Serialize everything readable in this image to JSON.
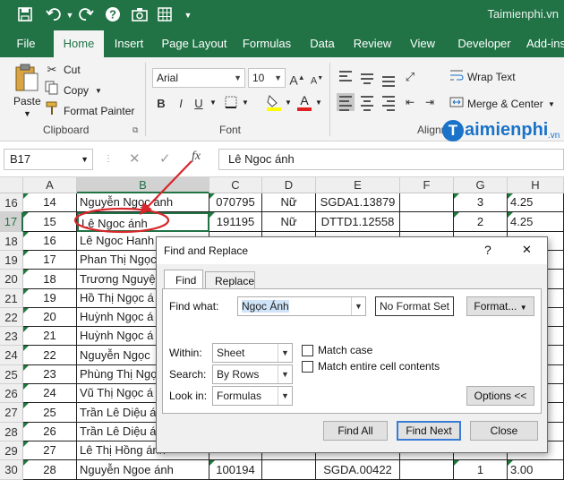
{
  "titlebar": {
    "watermark": "Taimienphi.vn"
  },
  "tabs": [
    "File",
    "Home",
    "Insert",
    "Page Layout",
    "Formulas",
    "Data",
    "Review",
    "View",
    "Developer",
    "Add-ins"
  ],
  "ribbon": {
    "paste": "Paste",
    "cut": "Cut",
    "copy": "Copy",
    "format_painter": "Format Painter",
    "clipboard": "Clipboard",
    "font_name": "Arial",
    "font_size": "10",
    "bold": "B",
    "italic": "I",
    "underline": "U",
    "font_group": "Font",
    "wrap_text": "Wrap Text",
    "merge_center": "Merge & Center",
    "alignment_group": "Alignm",
    "logo_text": "aimienphi",
    "logo_suffix": ".vn"
  },
  "formula_bar": {
    "name_box": "B17",
    "fx": "fx",
    "formula": "Lê Ngoc ánh"
  },
  "columns": [
    "A",
    "B",
    "C",
    "D",
    "E",
    "F",
    "G",
    "H"
  ],
  "rows": [
    {
      "num": "16",
      "a": "14",
      "b": "Nguyễn Ngọc ánh",
      "c": "070795",
      "d": "Nữ",
      "e": "SGDA1.13879",
      "f": "",
      "g": "3",
      "h": "4.25"
    },
    {
      "num": "17",
      "a": "15",
      "b": "Lê Ngoc ánh",
      "c": "191195",
      "d": "Nữ",
      "e": "DTTD1.12558",
      "f": "",
      "g": "2",
      "h": "4.25"
    },
    {
      "num": "18",
      "a": "16",
      "b": "Lê Ngoc Hanh",
      "c": "",
      "d": "",
      "e": "",
      "f": "",
      "g": "",
      "h": ""
    },
    {
      "num": "19",
      "a": "17",
      "b": "Phan Thị Ngọc",
      "c": "",
      "d": "",
      "e": "",
      "f": "",
      "g": "",
      "h": ""
    },
    {
      "num": "20",
      "a": "18",
      "b": "Trương Nguyệt",
      "c": "",
      "d": "",
      "e": "",
      "f": "",
      "g": "",
      "h": ""
    },
    {
      "num": "21",
      "a": "19",
      "b": "Hồ Thị Ngọc á",
      "c": "",
      "d": "",
      "e": "",
      "f": "",
      "g": "",
      "h": ""
    },
    {
      "num": "22",
      "a": "20",
      "b": "Huỳnh Ngọc á",
      "c": "",
      "d": "",
      "e": "",
      "f": "",
      "g": "",
      "h": ""
    },
    {
      "num": "23",
      "a": "21",
      "b": "Huỳnh Ngọc á",
      "c": "",
      "d": "",
      "e": "",
      "f": "",
      "g": "",
      "h": ""
    },
    {
      "num": "24",
      "a": "22",
      "b": "Nguyễn Ngọc",
      "c": "",
      "d": "",
      "e": "",
      "f": "",
      "g": "",
      "h": ""
    },
    {
      "num": "25",
      "a": "23",
      "b": "Phùng Thị Ngọ",
      "c": "",
      "d": "",
      "e": "",
      "f": "",
      "g": "",
      "h": ""
    },
    {
      "num": "26",
      "a": "24",
      "b": "Vũ Thị Ngọc á",
      "c": "",
      "d": "",
      "e": "",
      "f": "",
      "g": "",
      "h": ""
    },
    {
      "num": "27",
      "a": "25",
      "b": "Trần Lê Diệu á",
      "c": "",
      "d": "",
      "e": "",
      "f": "",
      "g": "",
      "h": ""
    },
    {
      "num": "28",
      "a": "26",
      "b": "Trần Lê Diệu á",
      "c": "",
      "d": "",
      "e": "",
      "f": "",
      "g": "",
      "h": ""
    },
    {
      "num": "29",
      "a": "27",
      "b": "Lê Thị Hồng ánh",
      "c": "",
      "d": "",
      "e": "",
      "f": "",
      "g": "",
      "h": ""
    },
    {
      "num": "30",
      "a": "28",
      "b": "Nguyễn Ngoe ánh",
      "c": "100194",
      "d": "",
      "e": "SGDA.00422",
      "f": "",
      "g": "1",
      "h": "3.00"
    }
  ],
  "dialog": {
    "title": "Find and Replace",
    "help": "?",
    "close_x": "✕",
    "tab_find": "Find",
    "tab_replace": "Replace",
    "find_what_label": "Find what:",
    "find_what_value": "Ngọc Ánh",
    "no_format_set": "No Format Set",
    "format_button": "Format...",
    "within_label": "Within:",
    "within_value": "Sheet",
    "search_label": "Search:",
    "search_value": "By Rows",
    "look_in_label": "Look in:",
    "look_in_value": "Formulas",
    "match_case": "Match case",
    "match_entire": "Match entire cell contents",
    "options_button": "Options <<",
    "find_all": "Find All",
    "find_next": "Find Next",
    "close": "Close"
  },
  "colors": {
    "excel_green": "#217346",
    "annotation_red": "#d8262b",
    "logo_blue": "#1a73c9"
  }
}
